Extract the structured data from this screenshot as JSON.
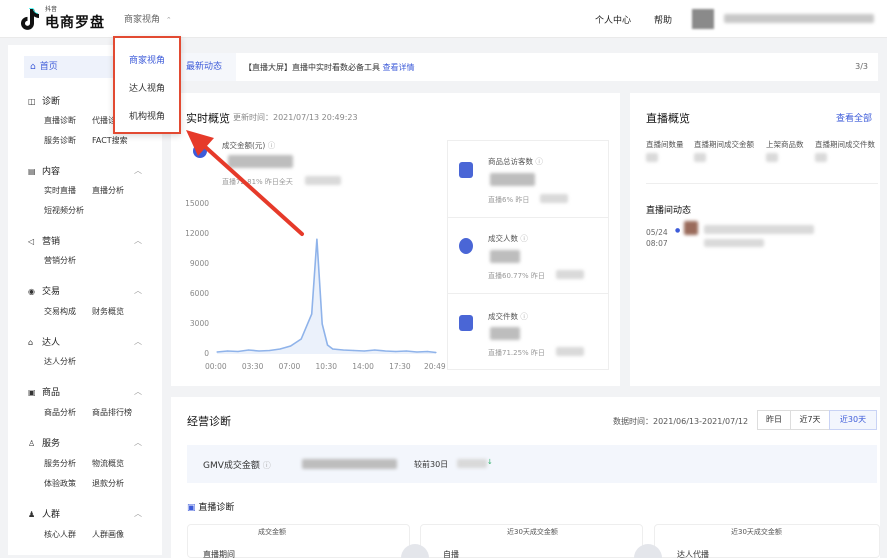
{
  "header": {
    "logo_small": "抖音",
    "logo_text": "电商罗盘",
    "view_switch": "商家视角",
    "view_switch_caret": "⌃",
    "nav": [
      "个人中心",
      "帮助"
    ]
  },
  "dropdown": {
    "items": [
      "商家视角",
      "达人视角",
      "机构视角"
    ],
    "active_index": 0
  },
  "sidebar": {
    "home": "首页",
    "home_icon": "home-icon",
    "groups": [
      {
        "icon": "diagnose-icon",
        "glyph": "◫",
        "label": "诊断",
        "items": [
          "直播诊断",
          "代播诊断",
          "服务诊断",
          "FACT搜索"
        ]
      },
      {
        "icon": "content-icon",
        "glyph": "▤",
        "label": "内容",
        "items": [
          "实时直播",
          "直播分析",
          "短视频分析"
        ]
      },
      {
        "icon": "marketing-icon",
        "glyph": "◁",
        "label": "营销",
        "items": [
          "营销分析"
        ]
      },
      {
        "icon": "trade-icon",
        "glyph": "◉",
        "label": "交易",
        "items": [
          "交易构成",
          "财务概览"
        ]
      },
      {
        "icon": "creator-icon",
        "glyph": "⌂",
        "label": "达人",
        "items": [
          "达人分析"
        ]
      },
      {
        "icon": "goods-icon",
        "glyph": "▣",
        "label": "商品",
        "items": [
          "商品分析",
          "商品排行榜"
        ]
      },
      {
        "icon": "service-icon",
        "glyph": "♙",
        "label": "服务",
        "items": [
          "服务分析",
          "物流概览",
          "体验政策",
          "退款分析"
        ]
      },
      {
        "icon": "crowd-icon",
        "glyph": "♟",
        "label": "人群",
        "items": [
          "核心人群",
          "人群画像"
        ]
      }
    ]
  },
  "banner": {
    "tab": "最新动态",
    "text": "【直播大屏】直播中实时看数必备工具",
    "link": "查看详情",
    "page": "3/3"
  },
  "realtime": {
    "title": "实时概览",
    "updated": "更新时间：2021/07/13 20:49:23",
    "gmv_label": "成交金额(元)",
    "gmv_compare": "直播72.81%  昨日全天",
    "side": [
      {
        "label": "商品总访客数",
        "note": "直播6%  昨日",
        "icon": "goods-visitor-icon"
      },
      {
        "label": "成交人数",
        "note": "直播60.77%  昨日",
        "icon": "buyer-icon"
      },
      {
        "label": "成交件数",
        "note": "直播71.25%  昨日",
        "icon": "order-icon"
      }
    ]
  },
  "chart_data": {
    "type": "line",
    "x": [
      "00:00",
      "01:00",
      "02:00",
      "03:00",
      "04:00",
      "05:00",
      "06:00",
      "07:00",
      "08:00",
      "09:00",
      "09:30",
      "10:00",
      "10:30",
      "11:00",
      "12:00",
      "13:00",
      "14:00",
      "15:00",
      "16:00",
      "17:00",
      "18:00",
      "19:00",
      "20:00",
      "20:49"
    ],
    "x_tick_labels": [
      "00:00",
      "03:30",
      "07:00",
      "10:30",
      "14:00",
      "17:30",
      "20:49"
    ],
    "values": [
      200,
      300,
      250,
      400,
      300,
      350,
      500,
      800,
      1500,
      4000,
      11500,
      3000,
      900,
      500,
      400,
      350,
      300,
      400,
      300,
      250,
      300,
      200,
      250,
      150
    ],
    "y_ticks": [
      0,
      3000,
      6000,
      9000,
      12000,
      15000
    ],
    "ylim": [
      0,
      15000
    ],
    "color": "#8fb3ea",
    "grid": false
  },
  "live": {
    "title": "直播概览",
    "link": "查看全部",
    "columns": [
      "直播间数量",
      "直播期间成交金额",
      "上架商品数",
      "直播期间成交件数"
    ],
    "dynamics_title": "直播间动态",
    "dynamics_date": "05/24",
    "dynamics_time": "08:07"
  },
  "diagnose": {
    "title": "经营诊断",
    "date_range": "数据时间：2021/06/13-2021/07/12",
    "ranges": [
      "昨日",
      "近7天",
      "近30天"
    ],
    "active_range": 2,
    "gmv_label": "GMV成交金额",
    "compare_label": "较前30日",
    "live_diag_title": "直播诊断",
    "sub_cards": [
      {
        "label": "成交金额",
        "name": "直播期间"
      },
      {
        "label": "近30天成交金额",
        "name": "自播"
      },
      {
        "label": "近30天成交金额",
        "name": "达人代播"
      }
    ]
  }
}
